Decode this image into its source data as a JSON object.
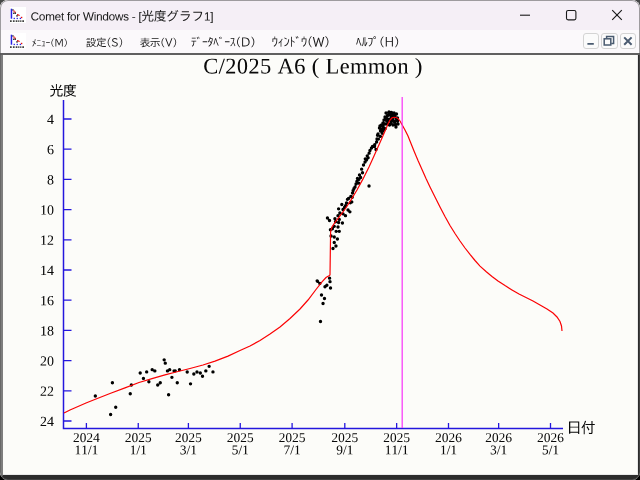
{
  "window": {
    "app_icon": "comet-lightcurve-chart-icon",
    "title": "Comet for Windows - [光度グラフ1]",
    "controls": {
      "minimize": "最小化",
      "maximize": "最大化",
      "close": "閉じる"
    }
  },
  "menu": {
    "items": [
      {
        "id": "menu",
        "label": "ﾒﾆｭｰ(M)"
      },
      {
        "id": "settings",
        "label": "設定(S)"
      },
      {
        "id": "view",
        "label": "表示(V)"
      },
      {
        "id": "database",
        "label": "ﾃﾞｰﾀﾍﾞｰｽ(D)"
      },
      {
        "id": "window",
        "label": "ｳｨﾝﾄﾞｳ(W)"
      },
      {
        "id": "help",
        "label": "ﾍﾙﾌﾟ(H)"
      }
    ],
    "mdi_controls": {
      "minimize": "最小化",
      "restore": "元に戻す",
      "close": "閉じる"
    }
  },
  "chart_data": {
    "type": "scatter",
    "title": "C/2025 A6 ( Lemmon )",
    "xlabel": "日付",
    "ylabel": "光度",
    "x_axis": {
      "epoch": "2024-11-01",
      "unit": "days since epoch",
      "min_day": -27,
      "max_day": 561,
      "ticks": [
        {
          "day": 0,
          "year": "2024",
          "date": "11/1"
        },
        {
          "day": 61,
          "year": "2025",
          "date": "1/1"
        },
        {
          "day": 120,
          "year": "2025",
          "date": "3/1"
        },
        {
          "day": 181,
          "year": "2025",
          "date": "5/1"
        },
        {
          "day": 242,
          "year": "2025",
          "date": "7/1"
        },
        {
          "day": 304,
          "year": "2025",
          "date": "9/1"
        },
        {
          "day": 365,
          "year": "2025",
          "date": "11/1"
        },
        {
          "day": 426,
          "year": "2026",
          "date": "1/1"
        },
        {
          "day": 485,
          "year": "2026",
          "date": "3/1"
        },
        {
          "day": 546,
          "year": "2026",
          "date": "5/1"
        }
      ]
    },
    "y_axis": {
      "inverted": true,
      "min_mag": 2.7,
      "max_mag": 24.6,
      "ticks": [
        4,
        6,
        8,
        10,
        12,
        14,
        16,
        18,
        20,
        22,
        24
      ]
    },
    "grid": false,
    "legend": false,
    "marker_line_day": 371.5,
    "series": [
      {
        "name": "observations",
        "type": "scatter",
        "color": "#000000",
        "points": [
          [
            10.5,
            22.34
          ],
          [
            30.6,
            21.47
          ],
          [
            34.5,
            23.09
          ],
          [
            28.5,
            23.57
          ],
          [
            51.6,
            22.2
          ],
          [
            52.9,
            21.62
          ],
          [
            63.3,
            20.82
          ],
          [
            67.1,
            21.18
          ],
          [
            70.9,
            20.75
          ],
          [
            73.5,
            21.4
          ],
          [
            77.4,
            20.6
          ],
          [
            80.5,
            20.68
          ],
          [
            83.9,
            21.62
          ],
          [
            86.9,
            21.47
          ],
          [
            91.5,
            19.95
          ],
          [
            92.8,
            20.17
          ],
          [
            95.4,
            20.68
          ],
          [
            98.0,
            20.6
          ],
          [
            100.6,
            21.11
          ],
          [
            103.2,
            20.68
          ],
          [
            106.9,
            21.47
          ],
          [
            109.5,
            20.6
          ],
          [
            96.7,
            22.26
          ],
          [
            104.5,
            20.68
          ],
          [
            118.6,
            20.75
          ],
          [
            122.5,
            21.54
          ],
          [
            126.4,
            20.89
          ],
          [
            130.1,
            20.75
          ],
          [
            134.0,
            20.82
          ],
          [
            136.6,
            21.04
          ],
          [
            140.5,
            20.68
          ],
          [
            144.4,
            20.38
          ],
          [
            148.9,
            20.75
          ],
          [
            275.4,
            17.41
          ],
          [
            271.9,
            14.75
          ],
          [
            280.7,
            15.11
          ],
          [
            286.6,
            14.77
          ],
          [
            271.5,
            14.72
          ],
          [
            274.6,
            14.89
          ],
          [
            282.9,
            15.01
          ],
          [
            287.2,
            15.19
          ],
          [
            286.1,
            14.54
          ],
          [
            276.6,
            15.66
          ],
          [
            280.1,
            15.89
          ],
          [
            278.4,
            16.22
          ],
          [
            287.8,
            11.75
          ],
          [
            291.6,
            11.81
          ],
          [
            295.3,
            11.95
          ],
          [
            291.6,
            12.18
          ],
          [
            293.6,
            12.41
          ],
          [
            290.1,
            12.58
          ],
          [
            283.6,
            10.56
          ],
          [
            286.0,
            10.72
          ],
          [
            292.4,
            10.61
          ],
          [
            296.0,
            10.4
          ],
          [
            293.1,
            10.81
          ],
          [
            296.7,
            10.85
          ],
          [
            301.2,
            10.89
          ],
          [
            291.6,
            11.11
          ],
          [
            296.0,
            11.15
          ],
          [
            289.4,
            11.27
          ],
          [
            293.8,
            11.44
          ],
          [
            297.5,
            11.44
          ],
          [
            297.5,
            10.65
          ],
          [
            287.1,
            11.33
          ],
          [
            307.1,
            9.32
          ],
          [
            312.2,
            9.49
          ],
          [
            300.5,
            9.66
          ],
          [
            296.7,
            9.95
          ],
          [
            301.9,
            9.99
          ],
          [
            307.8,
            10.03
          ],
          [
            310.0,
            10.15
          ],
          [
            298.2,
            10.23
          ],
          [
            301.9,
            10.28
          ],
          [
            304.8,
            10.4
          ],
          [
            304.9,
            9.74
          ],
          [
            310.5,
            9.55
          ],
          [
            312.7,
            9.18
          ],
          [
            318.2,
            8.13
          ],
          [
            320.5,
            8.0
          ],
          [
            322.6,
            7.87
          ],
          [
            320.5,
            8.25
          ],
          [
            324.8,
            7.56
          ],
          [
            323.8,
            7.32
          ],
          [
            328.1,
            6.64
          ],
          [
            330.4,
            6.44
          ],
          [
            332.6,
            6.26
          ],
          [
            331.4,
            6.57
          ],
          [
            339.2,
            5.7
          ],
          [
            341.4,
            5.52
          ],
          [
            343.5,
            5.33
          ],
          [
            345.8,
            5.15
          ],
          [
            342.5,
            5.08
          ],
          [
            348.0,
            4.95
          ],
          [
            349.1,
            4.77
          ],
          [
            351.3,
            4.65
          ],
          [
            316.0,
            8.5
          ],
          [
            313.8,
            8.74
          ],
          [
            332.5,
            8.44
          ],
          [
            338.9,
            5.82
          ],
          [
            340.7,
            6.02
          ],
          [
            345.4,
            4.46
          ],
          [
            347.2,
            4.66
          ],
          [
            348.9,
            4.26
          ],
          [
            350.1,
            4.07
          ],
          [
            351.3,
            3.87
          ],
          [
            352.5,
            3.6
          ],
          [
            354.2,
            3.8
          ],
          [
            354.8,
            4.13
          ],
          [
            356.0,
            3.54
          ],
          [
            357.2,
            3.74
          ],
          [
            358.4,
            3.93
          ],
          [
            358.9,
            3.57
          ],
          [
            360.1,
            3.8
          ],
          [
            360.7,
            4.07
          ],
          [
            361.9,
            3.6
          ],
          [
            363.1,
            3.87
          ],
          [
            364.2,
            4.13
          ],
          [
            364.8,
            3.67
          ],
          [
            366.0,
            3.93
          ],
          [
            366.6,
            4.33
          ],
          [
            364.2,
            4.53
          ],
          [
            360.7,
            4.4
          ],
          [
            356.6,
            4.4
          ],
          [
            352.5,
            4.33
          ],
          [
            350.1,
            4.6
          ],
          [
            347.8,
            4.86
          ],
          [
            343.1,
            4.99
          ],
          [
            341.9,
            5.32
          ],
          [
            351.9,
            4.07
          ],
          [
            353.6,
            3.97
          ],
          [
            355.4,
            3.74
          ],
          [
            357.8,
            3.64
          ],
          [
            359.5,
            3.7
          ],
          [
            361.3,
            3.87
          ],
          [
            363.1,
            3.74
          ],
          [
            364.8,
            3.97
          ],
          [
            362.5,
            4.2
          ],
          [
            358.9,
            4.17
          ],
          [
            356.6,
            4.03
          ],
          [
            353.1,
            4.1
          ],
          [
            354.8,
            4.3
          ],
          [
            358.4,
            4.3
          ],
          [
            363.6,
            4.36
          ],
          [
            366.0,
            4.13
          ],
          [
            350.7,
            4.33
          ],
          [
            348.9,
            4.5
          ],
          [
            347.2,
            4.4
          ],
          [
            348.4,
            4.7
          ],
          [
            346.0,
            4.79
          ],
          [
            344.8,
            4.6
          ],
          [
            326.0,
            7.05
          ],
          [
            327.8,
            6.85
          ],
          [
            329.5,
            6.72
          ],
          [
            333.6,
            6.09
          ],
          [
            335.4,
            5.92
          ],
          [
            336.6,
            5.82
          ],
          [
            321.3,
            7.71
          ],
          [
            318.9,
            7.94
          ],
          [
            317.2,
            8.3
          ],
          [
            314.8,
            8.6
          ],
          [
            313.1,
            8.9
          ],
          [
            311.1,
            9.13
          ],
          [
            308.4,
            9.26
          ],
          [
            306.0,
            9.56
          ],
          [
            303.6,
            9.86
          ]
        ]
      },
      {
        "name": "predicted-light-curve",
        "type": "line",
        "color": "#fb0204",
        "points": [
          [
            -26.4,
            23.47
          ],
          [
            -19.3,
            23.27
          ],
          [
            -9.9,
            23.04
          ],
          [
            -0.5,
            22.81
          ],
          [
            11.3,
            22.54
          ],
          [
            27.8,
            22.18
          ],
          [
            45.4,
            21.81
          ],
          [
            61.9,
            21.45
          ],
          [
            77.2,
            21.19
          ],
          [
            92.5,
            20.95
          ],
          [
            107.8,
            20.72
          ],
          [
            121.9,
            20.52
          ],
          [
            137.2,
            20.29
          ],
          [
            151.3,
            20.03
          ],
          [
            166.6,
            19.7
          ],
          [
            180.7,
            19.33
          ],
          [
            192.5,
            19.03
          ],
          [
            204.2,
            18.67
          ],
          [
            216.0,
            18.24
          ],
          [
            227.8,
            17.77
          ],
          [
            239.5,
            17.21
          ],
          [
            251.3,
            16.58
          ],
          [
            260.7,
            15.99
          ],
          [
            270.1,
            15.29
          ],
          [
            277.2,
            14.79
          ],
          [
            281.9,
            14.5
          ],
          [
            285.4,
            14.38
          ],
          [
            286.6,
            14.33
          ],
          [
            287.3,
            11.48
          ],
          [
            288.9,
            11.15
          ],
          [
            292.5,
            10.85
          ],
          [
            298.4,
            10.42
          ],
          [
            304.8,
            9.93
          ],
          [
            311.3,
            9.36
          ],
          [
            318.4,
            8.7
          ],
          [
            325.4,
            7.97
          ],
          [
            332.5,
            7.18
          ],
          [
            338.4,
            6.45
          ],
          [
            343.1,
            5.85
          ],
          [
            347.8,
            5.26
          ],
          [
            351.9,
            4.73
          ],
          [
            354.8,
            4.33
          ],
          [
            357.2,
            4.07
          ],
          [
            359.5,
            3.93
          ],
          [
            361.9,
            3.89
          ],
          [
            364.2,
            3.9
          ],
          [
            366.6,
            3.97
          ],
          [
            368.9,
            4.13
          ],
          [
            371.9,
            4.43
          ],
          [
            374.8,
            4.73
          ],
          [
            378.4,
            5.13
          ],
          [
            381.9,
            5.62
          ],
          [
            385.4,
            6.12
          ],
          [
            390.1,
            6.75
          ],
          [
            394.8,
            7.34
          ],
          [
            399.5,
            7.94
          ],
          [
            404.2,
            8.5
          ],
          [
            410.1,
            9.17
          ],
          [
            416.0,
            9.83
          ],
          [
            421.9,
            10.46
          ],
          [
            427.8,
            11.05
          ],
          [
            433.6,
            11.58
          ],
          [
            439.5,
            12.08
          ],
          [
            445.4,
            12.54
          ],
          [
            451.3,
            12.97
          ],
          [
            457.2,
            13.37
          ],
          [
            463.1,
            13.74
          ],
          [
            470.1,
            14.1
          ],
          [
            477.2,
            14.43
          ],
          [
            484.2,
            14.73
          ],
          [
            492.5,
            15.03
          ],
          [
            500.7,
            15.32
          ],
          [
            508.9,
            15.59
          ],
          [
            517.2,
            15.82
          ],
          [
            525.4,
            16.05
          ],
          [
            533.6,
            16.32
          ],
          [
            541.9,
            16.58
          ],
          [
            548.9,
            16.85
          ],
          [
            553.6,
            17.11
          ],
          [
            557.2,
            17.41
          ],
          [
            558.9,
            17.71
          ],
          [
            559.5,
            18.04
          ]
        ]
      }
    ]
  },
  "colors": {
    "titlebar_bg": "#f5eff6",
    "menubar_bg": "#fbf9fb",
    "client_bg": "#fcfcf9",
    "axis_blue": "#2417dd",
    "curve_red": "#fb0204",
    "marker_magenta": "#f829f8",
    "dot_black": "#000000",
    "text_black": "#0a0a0a"
  }
}
